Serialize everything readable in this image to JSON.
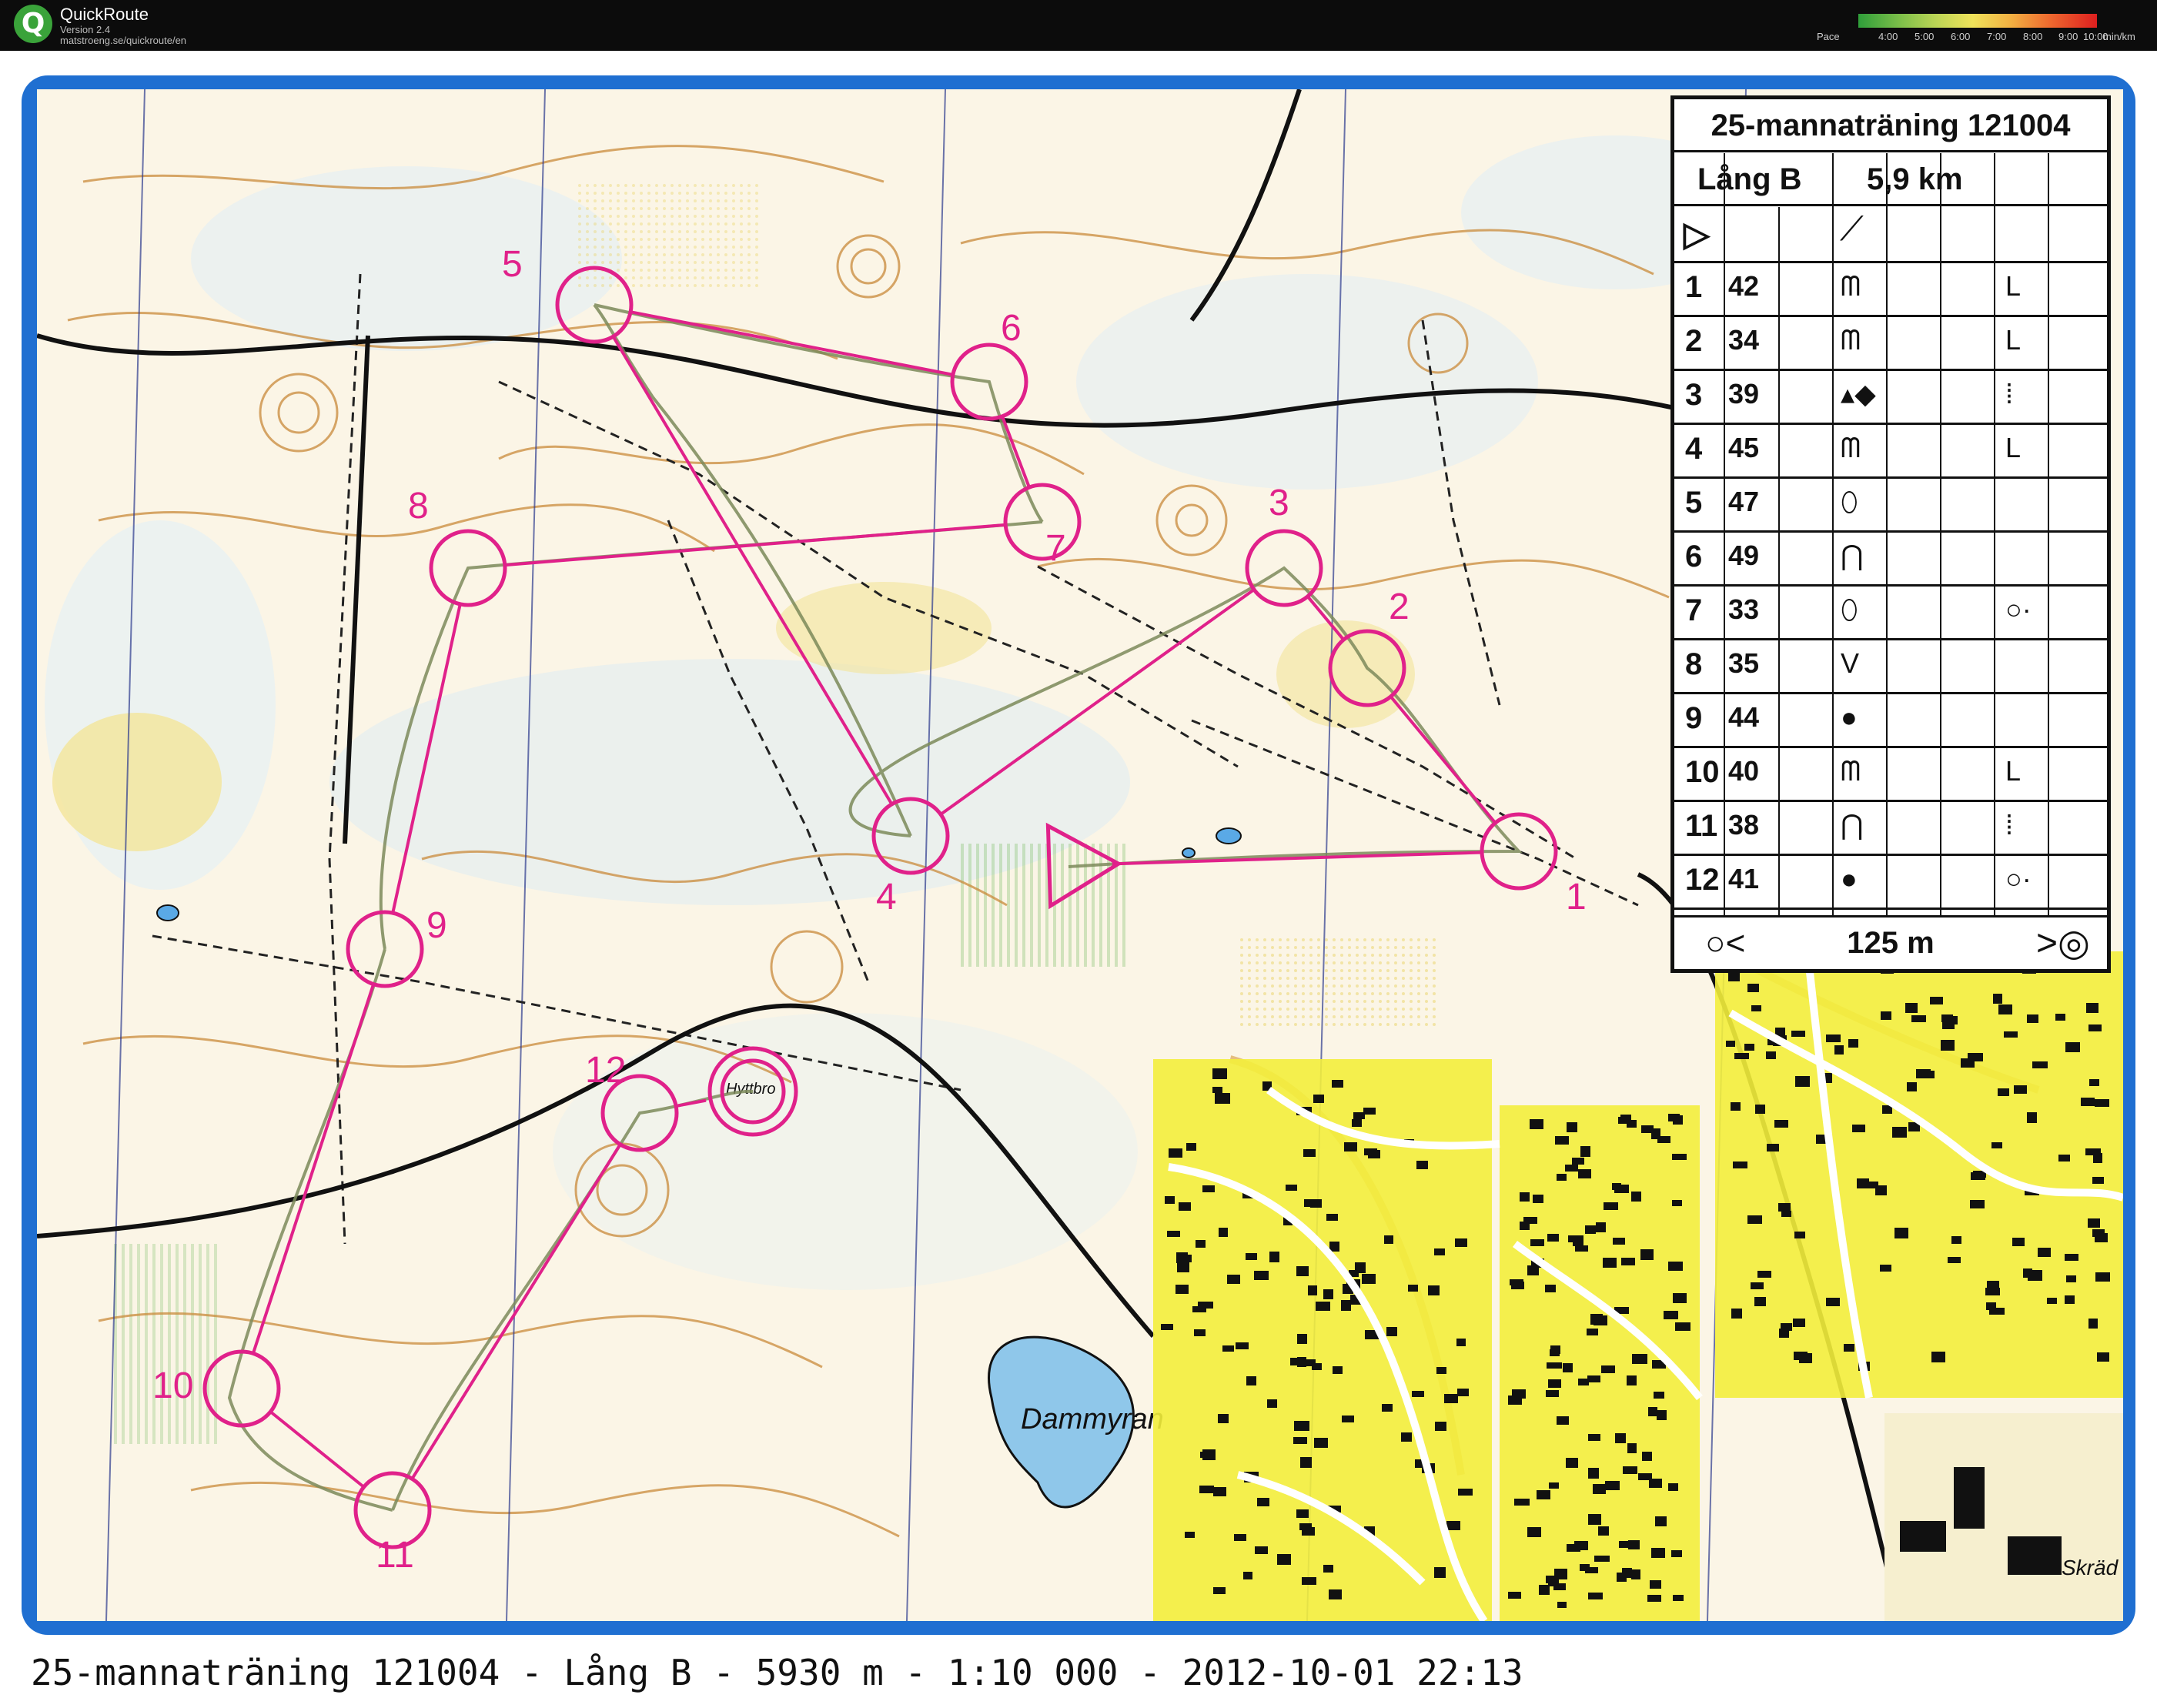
{
  "app": {
    "name": "QuickRoute",
    "version": "Version 2.4",
    "url": "matstroeng.se/quickroute/en",
    "pace_legend": {
      "label": "Pace",
      "ticks": [
        "4:00",
        "5:00",
        "6:00",
        "7:00",
        "8:00",
        "9:00",
        "10:00"
      ],
      "unit": "min/km"
    }
  },
  "map": {
    "course_color": "#e0218a",
    "frame_color": "#1f6fd1",
    "place_labels": [
      "Dammyran",
      "Hyttbro",
      "Skräd backs"
    ],
    "controls": [
      {
        "id": "start",
        "label": "",
        "type": "start"
      },
      {
        "id": "c1",
        "label": "1"
      },
      {
        "id": "c2",
        "label": "2"
      },
      {
        "id": "c3",
        "label": "3"
      },
      {
        "id": "c4",
        "label": "4"
      },
      {
        "id": "c5",
        "label": "5"
      },
      {
        "id": "c6",
        "label": "6"
      },
      {
        "id": "c7",
        "label": "7"
      },
      {
        "id": "c8",
        "label": "8"
      },
      {
        "id": "c9",
        "label": "9"
      },
      {
        "id": "c10",
        "label": "10"
      },
      {
        "id": "c11",
        "label": "11"
      },
      {
        "id": "c12",
        "label": "12"
      },
      {
        "id": "finish",
        "label": "",
        "type": "finish"
      }
    ]
  },
  "description_sheet": {
    "title": "25-mannaträning 121004",
    "course": "Lång B",
    "length": "5,9 km",
    "rows": [
      {
        "num": "1",
        "code": "42",
        "feature": "stone-wall-symbol",
        "location": "corner-symbol"
      },
      {
        "num": "2",
        "code": "34",
        "feature": "stone-wall-symbol",
        "location": "corner-symbol"
      },
      {
        "num": "3",
        "code": "39",
        "feature": "boulders-symbol",
        "location": "between-symbol"
      },
      {
        "num": "4",
        "code": "45",
        "feature": "stone-wall-symbol",
        "location": "corner-symbol"
      },
      {
        "num": "5",
        "code": "47",
        "feature": "knoll-symbol",
        "location": ""
      },
      {
        "num": "6",
        "code": "49",
        "feature": "spur-symbol",
        "location": ""
      },
      {
        "num": "7",
        "code": "33",
        "feature": "knoll-symbol",
        "location": "east-side-symbol"
      },
      {
        "num": "8",
        "code": "35",
        "feature": "re-entrant-symbol",
        "location": ""
      },
      {
        "num": "9",
        "code": "44",
        "feature": "boulder-symbol",
        "location": ""
      },
      {
        "num": "10",
        "code": "40",
        "feature": "stone-wall-symbol",
        "location": "corner-symbol"
      },
      {
        "num": "11",
        "code": "38",
        "feature": "spur-symbol",
        "location": "between-symbol"
      },
      {
        "num": "12",
        "code": "41",
        "feature": "boulder-symbol",
        "location": "east-side-symbol"
      }
    ],
    "finish_distance": "125 m"
  },
  "caption": "25-mannaträning 121004 - Lång B - 5930 m - 1:10 000 - 2012-10-01 22:13"
}
